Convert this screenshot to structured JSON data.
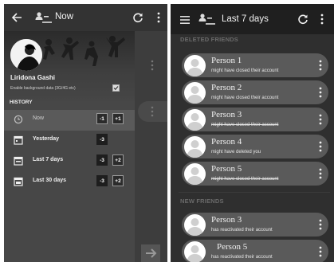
{
  "left": {
    "header": {
      "back_icon": "arrow-left-icon",
      "title": "Now",
      "refresh_icon": "refresh-icon",
      "menu_icon": "more-vert-icon"
    },
    "profile": {
      "name": "Liridona Gashi",
      "setting": "Enable background data (3G/4G etc)",
      "checkbox_checked": true
    },
    "history_label": "HISTORY",
    "history": [
      {
        "label": "Now",
        "icon": "clock-icon",
        "badges": [
          "-1",
          "+1"
        ],
        "active": false
      },
      {
        "label": "Yesterday",
        "icon": "calendar-icon",
        "badges": [
          "-3"
        ],
        "active": true
      },
      {
        "label": "Last 7 days",
        "icon": "calendar-week-icon",
        "badges": [
          "-3",
          "+2"
        ],
        "active": true
      },
      {
        "label": "Last 30 days",
        "icon": "calendar-month-icon",
        "badges": [
          "-3",
          "+2"
        ],
        "active": true
      }
    ]
  },
  "right": {
    "header": {
      "menu_icon": "hamburger-icon",
      "title": "Last 7 days",
      "refresh_icon": "refresh-icon",
      "more_icon": "more-vert-icon"
    },
    "deleted_label": "DELETED FRIENDS",
    "deleted": [
      {
        "name": "Person 1",
        "status": "might have closed their account",
        "strike": false
      },
      {
        "name": "Person 2",
        "status": "might have closed their account",
        "strike": false
      },
      {
        "name": "Person 3",
        "status": "might have closed their account",
        "strike": true
      },
      {
        "name": "Person 4",
        "status": "might have deleted you",
        "strike": false
      },
      {
        "name": "Person 5",
        "status": "might have closed their account",
        "strike": true
      }
    ],
    "new_label": "NEW FRIENDS",
    "new": [
      {
        "name": "Person 3",
        "status": "has reactivated their account",
        "strike": false
      },
      {
        "name": "Person 5",
        "status": "has reactivated their account",
        "strike": false
      }
    ]
  }
}
